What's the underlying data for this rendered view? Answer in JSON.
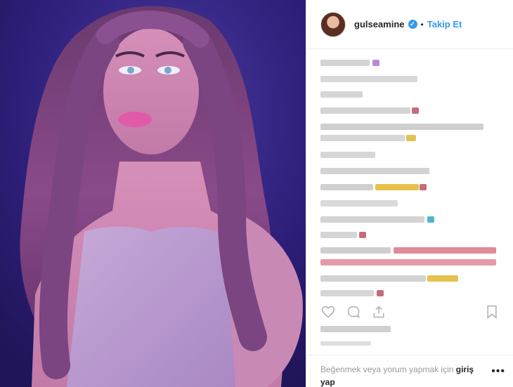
{
  "post": {
    "username": "gulseamine",
    "verified": true,
    "separator": "•",
    "follow_label": "Takip Et",
    "verified_glyph": "✓"
  },
  "footer": {
    "prompt_text": "Beğenmek veya yorum yapmak için",
    "login_label": "giriş yap",
    "more_glyph": "•••"
  },
  "icons": {
    "like": "heart-icon",
    "comment": "comment-icon",
    "share": "share-icon",
    "save": "bookmark-icon",
    "verified": "verified-badge-icon"
  },
  "colors": {
    "link_blue": "#3897f0",
    "text_dark": "#262626",
    "text_muted": "#999999",
    "photo_background": "#2b1d78"
  }
}
